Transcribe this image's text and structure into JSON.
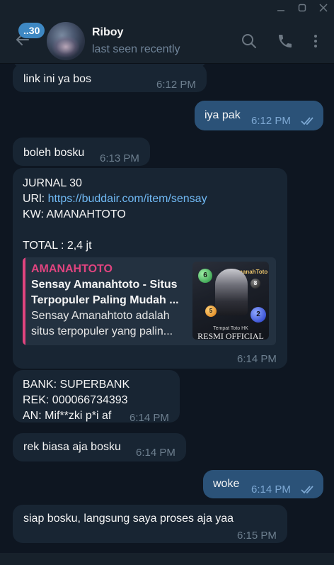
{
  "header": {
    "unread_badge": "..30",
    "chat_name": "Riboy",
    "status": "last seen recently"
  },
  "messages": [
    {
      "id": "m0",
      "dir": "in",
      "text": "link ini ya bos",
      "time": "6:12 PM"
    },
    {
      "id": "m1",
      "dir": "out",
      "text": "iya pak",
      "time": "6:12 PM",
      "read": true
    },
    {
      "id": "m2",
      "dir": "in",
      "text": "boleh bosku",
      "time": "6:13 PM"
    },
    {
      "id": "m3",
      "dir": "in",
      "line1": "JURNAL 30",
      "url_label": "URl: ",
      "url": "https://buddair.com/item/sensay",
      "line3": "KW: AMANAHTOTO",
      "line5": "TOTAL : 2,4 jt",
      "time": "6:14 PM",
      "preview": {
        "site": "AMANAHTOTO",
        "title": "Sensay Amanahtoto - Situs Terpopuler Paling Mudah ...",
        "description": "Sensay Amanahtoto adalah situs terpopuler yang palin...",
        "image_logo": "AmanahToto",
        "image_tagline": "Tempat Toto HK",
        "image_caption": "RESMI OFFICIAL"
      }
    },
    {
      "id": "m4",
      "dir": "in",
      "line1": "BANK: SUPERBANK",
      "line2": "REK: 000066734393",
      "line3": "AN: Mif**zki p*i af",
      "time": "6:14 PM"
    },
    {
      "id": "m5",
      "dir": "in",
      "text": "rek biasa aja bosku",
      "time": "6:14 PM"
    },
    {
      "id": "m6",
      "dir": "out",
      "text": "woke",
      "time": "6:14 PM",
      "read": true
    },
    {
      "id": "m7",
      "dir": "in",
      "text": "siap bosku, langsung saya proses aja yaa",
      "time": "6:15 PM"
    }
  ],
  "colors": {
    "background": "#0e1621",
    "incoming_bubble": "#182533",
    "outgoing_bubble": "#2b5278",
    "accent": "#3e88c3",
    "link": "#71baf5",
    "preview_accent": "#e0447f"
  },
  "icons": [
    "minimize-icon",
    "maximize-icon",
    "close-icon",
    "back-arrow-icon",
    "search-icon",
    "phone-icon",
    "more-vert-icon",
    "double-check-icon"
  ]
}
